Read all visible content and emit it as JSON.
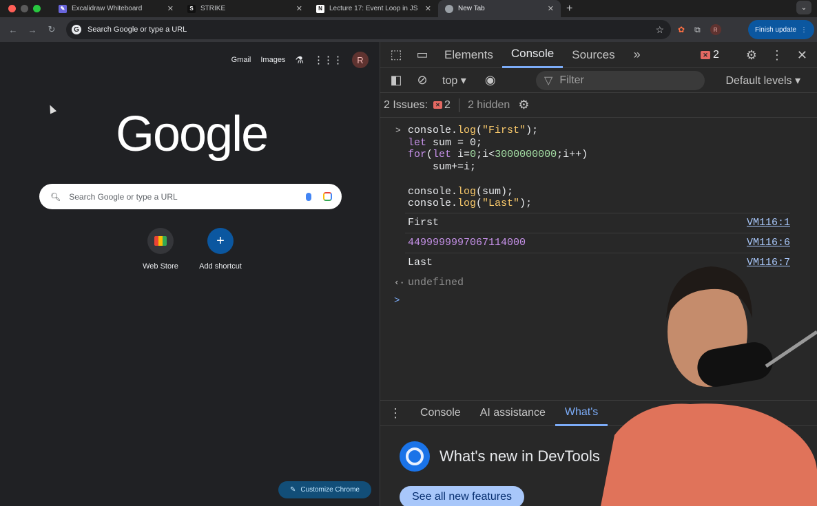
{
  "browser": {
    "tabs": [
      {
        "label": "Excalidraw Whiteboard",
        "icon": "excalidraw-icon"
      },
      {
        "label": "STRIKE",
        "icon": "strike-icon"
      },
      {
        "label": "Lecture 17: Event Loop in JS",
        "icon": "notion-icon"
      },
      {
        "label": "New Tab",
        "icon": "chrome-icon",
        "active": true
      }
    ],
    "omnibox_placeholder": "Search Google or type a URL",
    "avatar_initial": "R",
    "finish_update": "Finish update"
  },
  "ntp": {
    "gmail": "Gmail",
    "images": "Images",
    "avatar_initial": "R",
    "logo": "Google",
    "search_placeholder": "Search Google or type a URL",
    "shortcuts": [
      {
        "label": "Web Store",
        "icon": "webstore-icon"
      },
      {
        "label": "Add shortcut",
        "icon": "plus-icon"
      }
    ],
    "customize": "Customize Chrome"
  },
  "devtools": {
    "tabs": [
      "Elements",
      "Console",
      "Sources"
    ],
    "active_tab": "Console",
    "error_count": "2",
    "context": "top",
    "filter_placeholder": "Filter",
    "levels": "Default levels",
    "issues_label": "2 Issues:",
    "issues_count": "2",
    "hidden": "2 hidden",
    "code_lines": [
      "console.log(\"First\");",
      "let sum = 0;",
      "for(let i=0;i<3000000000;i++)",
      "    sum+=i;",
      "",
      "console.log(sum);",
      "console.log(\"Last\");"
    ],
    "logs": [
      {
        "text": "First",
        "link": "VM116:1"
      },
      {
        "text": "4499999997067114000",
        "link": "VM116:6"
      },
      {
        "text": "Last",
        "link": "VM116:7"
      }
    ],
    "return_value": "undefined",
    "drawer_tabs": [
      "Console",
      "AI assistance",
      "What's"
    ],
    "whats_new_title": "What's new in DevTools",
    "see_all": "See all new features"
  },
  "colors": {
    "accent": "#7cacf8",
    "error": "#e46962",
    "finish_update_bg": "#0b57a0"
  }
}
